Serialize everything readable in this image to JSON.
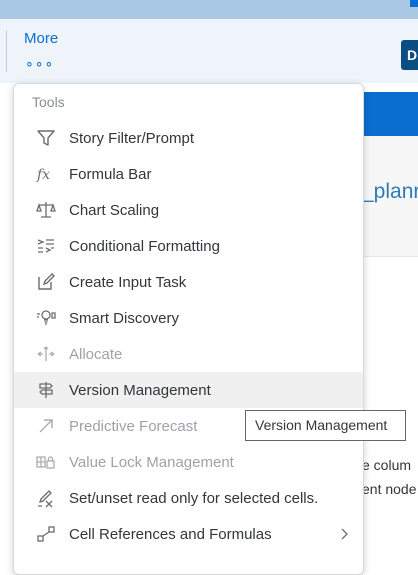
{
  "toolbar": {
    "more_label": "More",
    "more_dots": "∘∘∘",
    "button_text": "D"
  },
  "background": {
    "title_fragment": "_planr",
    "text_line1": "e colum",
    "text_line2": "ent node"
  },
  "menu": {
    "header": "Tools",
    "items": [
      {
        "label": "Story Filter/Prompt",
        "icon": "filter-icon",
        "enabled": true
      },
      {
        "label": "Formula Bar",
        "icon": "fx-icon",
        "enabled": true
      },
      {
        "label": "Chart Scaling",
        "icon": "scale-icon",
        "enabled": true
      },
      {
        "label": "Conditional Formatting",
        "icon": "conditional-format-icon",
        "enabled": true
      },
      {
        "label": "Create Input Task",
        "icon": "edit-icon",
        "enabled": true
      },
      {
        "label": "Smart Discovery",
        "icon": "lightbulb-icon",
        "enabled": true
      },
      {
        "label": "Allocate",
        "icon": "allocate-icon",
        "enabled": false
      },
      {
        "label": "Version Management",
        "icon": "signpost-icon",
        "enabled": true,
        "hovered": true
      },
      {
        "label": "Predictive Forecast",
        "icon": "arrow-up-right-icon",
        "enabled": false
      },
      {
        "label": "Value Lock Management",
        "icon": "value-lock-icon",
        "enabled": false
      },
      {
        "label": "Set/unset read only for selected cells.",
        "icon": "pencil-slash-icon",
        "enabled": true
      },
      {
        "label": "Cell References and Formulas",
        "icon": "cell-reference-icon",
        "enabled": true,
        "has_submenu": true
      }
    ]
  },
  "tooltip": {
    "text": "Version Management"
  },
  "colors": {
    "accent": "#0a6ed1",
    "hover": "#f0f0f0",
    "disabled_text": "#9ea3a8"
  }
}
